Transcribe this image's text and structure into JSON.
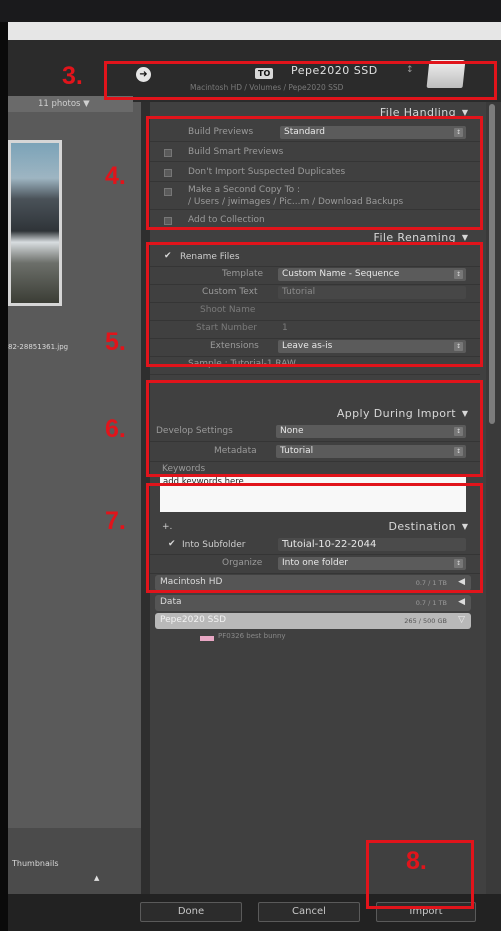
{
  "destination": {
    "to_label": "TO",
    "drive_name": "Pepe2020 SSD",
    "drive_dropdown": "↕",
    "path": "Macintosh HD / Volumes / Pepe2020 SSD",
    "go_icon": "arrow-right-circle-icon"
  },
  "grid": {
    "photos_count": "11 photos ▼",
    "file_label": "82-28851361.jpg",
    "thumbnails_label": "Thumbnails",
    "thumb_handle": "▲"
  },
  "file_handling": {
    "title": "File Handling",
    "build_previews_label": "Build Previews",
    "build_previews_value": "Standard",
    "smart_previews": "Build Smart Previews",
    "no_duplicates": "Don't Import Suspected Duplicates",
    "second_copy": "Make a Second Copy To :",
    "second_copy_path": "/ Users / jwimages / Pic...m / Download Backups",
    "add_collection": "Add to Collection"
  },
  "file_renaming": {
    "title": "File Renaming",
    "rename_files": "Rename Files",
    "template_label": "Template",
    "template_value": "Custom Name - Sequence",
    "custom_text_label": "Custom Text",
    "custom_text_value": "Tutorial",
    "shoot_name_label": "Shoot Name",
    "start_number_label": "Start Number",
    "start_number_value": "1",
    "extensions_label": "Extensions",
    "extensions_value": "Leave as-is",
    "sample": "Sample : Tutorial-1.RAW"
  },
  "apply_during_import": {
    "title": "Apply During Import",
    "develop_label": "Develop Settings",
    "develop_value": "None",
    "metadata_label": "Metadata",
    "metadata_value": "Tutorial",
    "keywords_label": "Keywords",
    "keywords_text": "add keywords here"
  },
  "destination_panel": {
    "title": "Destination",
    "add_icon": "+.",
    "into_subfolder_label": "Into Subfolder",
    "subfolder_value": "Tutoial-10-22-2044",
    "organize_label": "Organize",
    "organize_value": "Into one folder",
    "volumes": [
      {
        "name": "Macintosh HD",
        "size": "0.7 / 1 TB"
      },
      {
        "name": "Data",
        "size": "0.7 / 1 TB"
      },
      {
        "name": "Pepe2020 SSD",
        "size": "265 / 500 GB"
      }
    ],
    "subfolder_item": "PF0326 best bunny"
  },
  "buttons": {
    "done": "Done",
    "cancel": "Cancel",
    "import": "Import"
  },
  "annotations": [
    "3.",
    "4.",
    "5.",
    "6.",
    "7.",
    "8."
  ],
  "colors": {
    "annotation_red": "#e1141b",
    "panel_bg": "#404040"
  }
}
